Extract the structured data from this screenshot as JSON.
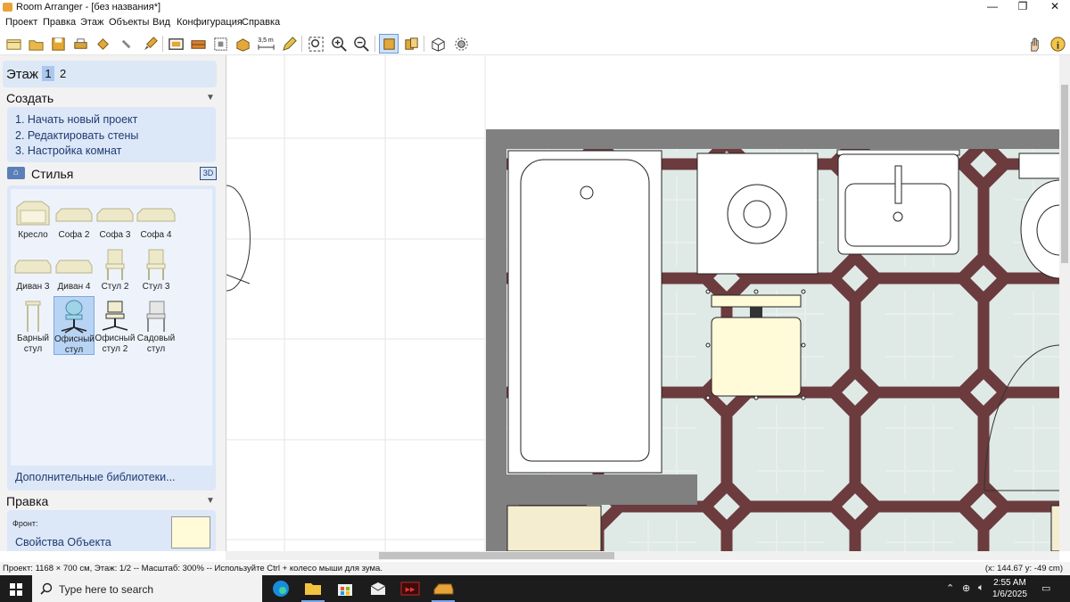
{
  "window": {
    "title": "Room Arranger - [без названия*]",
    "controls": {
      "minimize": "—",
      "maximize": "❐",
      "close": "✕"
    }
  },
  "menu": [
    "Проект",
    "Правка",
    "Этаж",
    "Объекты",
    "Вид",
    "Конфигурация",
    "Справка"
  ],
  "toolbar": {
    "icons": [
      "new-project-icon",
      "open-icon",
      "save-icon",
      "print-icon",
      "undo-icon",
      "redo-icon",
      "paint-icon",
      "walls-icon",
      "bricks-icon",
      "floor-plan-icon",
      "objects-icon",
      "measure-icon",
      "pencil-icon",
      "zoom-fit-icon",
      "zoom-in-icon",
      "zoom-out-icon",
      "view-2d-icon",
      "view-3d-icon",
      "3d-box-icon",
      "settings-icon",
      "hand-icon",
      "info-icon"
    ],
    "measure_label": "3,5 m"
  },
  "sidebar": {
    "floor_label": "Этаж",
    "floors": [
      "1",
      "2"
    ],
    "create_title": "Создать",
    "create_items": [
      "1. Начать новый проект",
      "2. Редактировать стены",
      "3. Настройка комнат"
    ],
    "styles_title": "Стилья",
    "btn_3d": "3D",
    "library": [
      {
        "name": "Кресло",
        "icon": "armchair-icon"
      },
      {
        "name": "Софа 2",
        "icon": "sofa-icon"
      },
      {
        "name": "Софа 3",
        "icon": "sofa-icon"
      },
      {
        "name": "Софа 4",
        "icon": "sofa-icon"
      },
      {
        "name": "Диван 3",
        "icon": "couch-icon"
      },
      {
        "name": "Диван 4",
        "icon": "couch-icon"
      },
      {
        "name": "Стул 2",
        "icon": "chair-icon"
      },
      {
        "name": "Стул 3",
        "icon": "chair-icon"
      },
      {
        "name": "Барный стул",
        "icon": "bar-stool-icon"
      },
      {
        "name": "Офисный стул",
        "icon": "office-chair-icon"
      },
      {
        "name": "Офисный стул 2",
        "icon": "office-chair-icon"
      },
      {
        "name": "Садовый стул",
        "icon": "garden-chair-icon"
      }
    ],
    "selected_item": "Офисный стул",
    "more_libraries": "Дополнительные библиотеки...",
    "edit_title": "Правка",
    "front_label": "Фронт:",
    "object_props": "Свойства Объекта",
    "front_color": "#fffbd9"
  },
  "status": {
    "left": "Проект: 1168 × 700 см, Этаж: 1/2 -- Масштаб: 300% -- Используйте Ctrl + колесо мыши для зума.",
    "right": "(x: 144.67 y: -49 cm)"
  },
  "taskbar": {
    "search_placeholder": "Type here to search",
    "time": "2:55 AM",
    "date": "1/6/2025",
    "apps": [
      "edge-icon",
      "file-explorer-icon",
      "store-icon",
      "mail-icon",
      "media-app-icon",
      "room-arranger-icon"
    ]
  },
  "colors": {
    "sidebar_panel": "#dce7f8",
    "wall": "#808080",
    "tile_light": "#dfe9e6",
    "tile_dark": "#6b3b3e",
    "object_fill": "#fffbd9"
  }
}
